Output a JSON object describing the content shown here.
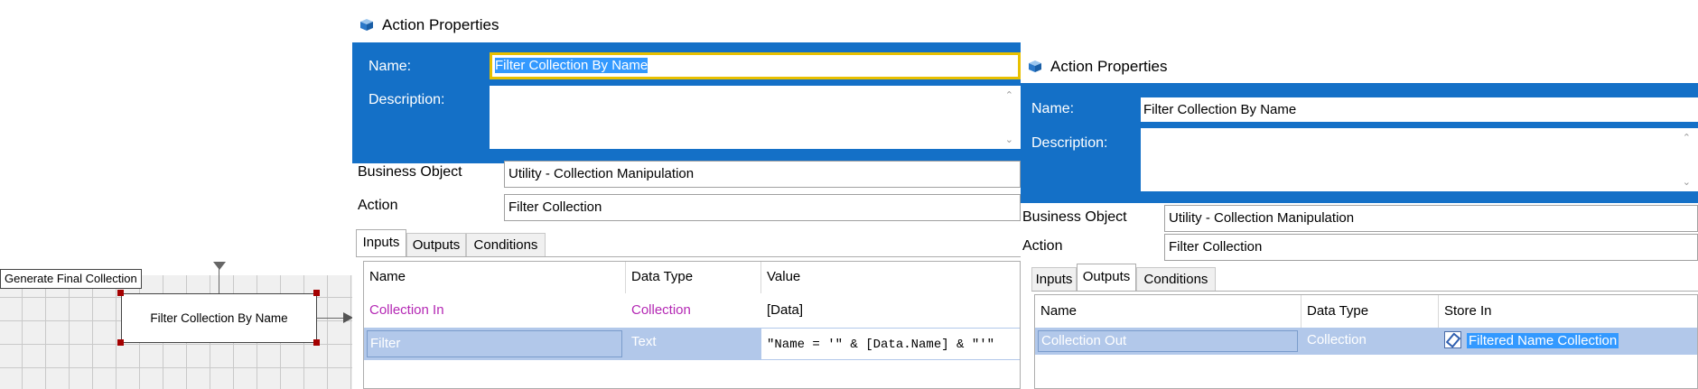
{
  "canvas": {
    "prev_stage_label": "Generate Final Collection",
    "stage_label": "Filter Collection By Name"
  },
  "dialog_left": {
    "title": "Action Properties",
    "name_label": "Name:",
    "name_value": "Filter Collection By Name",
    "description_label": "Description:",
    "description_value": "",
    "business_object_label": "Business Object",
    "business_object_value": "Utility - Collection Manipulation",
    "action_label": "Action",
    "action_value": "Filter Collection",
    "tabs": [
      {
        "label": "Inputs",
        "active": true
      },
      {
        "label": "Outputs",
        "active": false
      },
      {
        "label": "Conditions",
        "active": false
      }
    ],
    "columns": [
      "Name",
      "Data Type",
      "Value"
    ],
    "rows": [
      {
        "name": "Collection In",
        "type": "Collection",
        "value": "[Data]"
      },
      {
        "name": "Filter",
        "type": "Text",
        "value": "\"Name = '\" & [Data.Name] & \"'\""
      }
    ]
  },
  "dialog_right": {
    "title": "Action Properties",
    "name_label": "Name:",
    "name_value": "Filter Collection By Name",
    "description_label": "Description:",
    "description_value": "",
    "business_object_label": "Business Object",
    "business_object_value": "Utility - Collection Manipulation",
    "action_label": "Action",
    "action_value": "Filter Collection",
    "tabs": [
      {
        "label": "Inputs",
        "active": false
      },
      {
        "label": "Outputs",
        "active": true
      },
      {
        "label": "Conditions",
        "active": false
      }
    ],
    "columns": [
      "Name",
      "Data Type",
      "Store In"
    ],
    "rows": [
      {
        "name": "Collection Out",
        "type": "Collection",
        "store_in": "Filtered Name Collection"
      }
    ]
  },
  "colors": {
    "panel_blue": "#1470c7",
    "focus_yellow": "#e8c000",
    "selection_blue": "#3399ff",
    "selected_row": "#b2c8ea",
    "param_purple": "#b428b4",
    "stage_handle": "#a40000"
  },
  "icons": {
    "title": "action-properties-icon",
    "store_in": "data-item-icon"
  }
}
